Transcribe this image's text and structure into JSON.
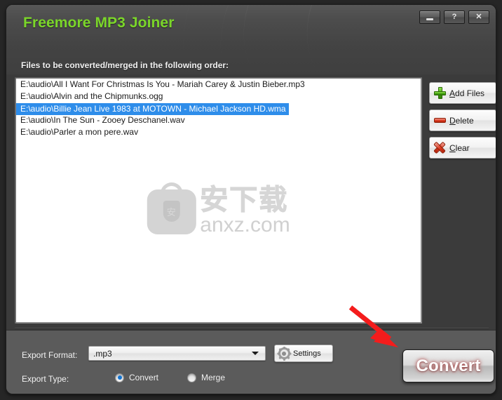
{
  "window": {
    "app_title": "Freemore MP3 Joiner",
    "subtitle": "Files to be converted/merged in the following order:",
    "titlebar": {
      "minimize_label": "",
      "help_label": "?",
      "close_label": "✕"
    }
  },
  "file_list": {
    "items": [
      {
        "path": "E:\\audio\\All I Want For Christmas Is You - Mariah Carey & Justin Bieber.mp3",
        "selected": false
      },
      {
        "path": "E:\\audio\\Alvin and the Chipmunks.ogg",
        "selected": false
      },
      {
        "path": "E:\\audio\\Billie Jean Live 1983 at MOTOWN - Michael Jackson HD.wma",
        "selected": true
      },
      {
        "path": "E:\\audio\\In The Sun - Zooey Deschanel.wav",
        "selected": false
      },
      {
        "path": "E:\\audio\\Parler a mon pere.wav",
        "selected": false
      }
    ],
    "selection_color": "#2e8dea"
  },
  "watermark": {
    "cn_text": "安下载",
    "domain_text": "anxz.com",
    "logo_glyph": "安",
    "color": "#d4d4d4"
  },
  "side_buttons": [
    {
      "label_pre": "",
      "accel": "A",
      "label_post": "dd Files",
      "icon": "plus-icon"
    },
    {
      "label_pre": "",
      "accel": "D",
      "label_post": "elete",
      "icon": "minus-icon"
    },
    {
      "label_pre": "",
      "accel": "C",
      "label_post": "lear",
      "icon": "x-icon"
    }
  ],
  "footer": {
    "export_format_label": "Export Format:",
    "export_format_value": ".mp3",
    "export_type_label": "Export Type:",
    "settings_label": "Settings",
    "radios": [
      {
        "label": "Convert",
        "checked": true
      },
      {
        "label": "Merge",
        "checked": false
      }
    ],
    "convert_button_label": "Convert"
  },
  "annotation": {
    "arrow_color": "#f41c1c"
  },
  "colors": {
    "title_green": "#7bd62a",
    "header_dark": "#434343",
    "panel_dark": "#3b3b3b",
    "panel_light": "#5b5b5b",
    "radio_blue": "#1273d1"
  }
}
